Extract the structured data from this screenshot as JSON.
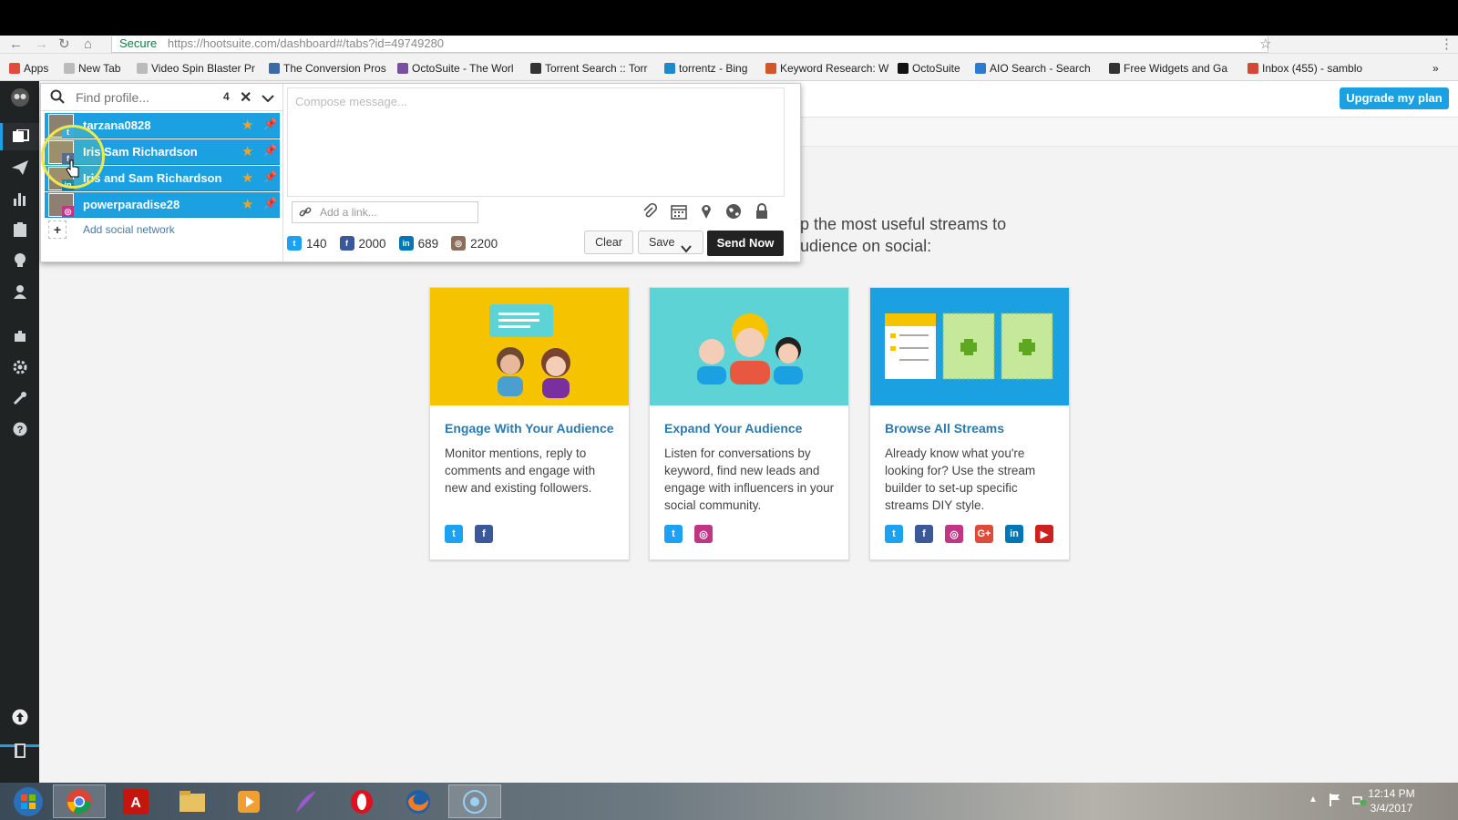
{
  "browser": {
    "secure_label": "Secure",
    "url": "https://hootsuite.com/dashboard#/tabs?id=49749280",
    "bookmarks": [
      {
        "label": "Apps",
        "color": "#e34b3c"
      },
      {
        "label": "New Tab",
        "color": "#bbbbbb"
      },
      {
        "label": "Video Spin Blaster Pr",
        "color": "#bbbbbb"
      },
      {
        "label": "The Conversion Pros",
        "color": "#3b6aa6"
      },
      {
        "label": "OctoSuite - The Worl",
        "color": "#7b4fa0"
      },
      {
        "label": "Torrent Search :: Torr",
        "color": "#333333"
      },
      {
        "label": "torrentz - Bing",
        "color": "#1e88c8"
      },
      {
        "label": "Keyword Research: W",
        "color": "#d3552a"
      },
      {
        "label": "OctoSuite",
        "color": "#111111"
      },
      {
        "label": "AIO Search - Search",
        "color": "#2d7bd1"
      },
      {
        "label": "Free Widgets and Ga",
        "color": "#333333"
      },
      {
        "label": "Inbox (455) - samblo",
        "color": "#d44638"
      }
    ],
    "more": "»"
  },
  "topbar": {
    "upgrade_label": "Upgrade my plan",
    "intro_text": "p the most useful streams to\nudience on social:"
  },
  "composer": {
    "find_placeholder": "Find profile...",
    "selected_count": "4",
    "profiles": [
      {
        "name": "tarzana0828",
        "network": "twitter"
      },
      {
        "name": "Iris Sam Richardson",
        "network": "facebook"
      },
      {
        "name": "Iris and Sam Richardson",
        "network": "linkedin"
      },
      {
        "name": "powerparadise28",
        "network": "instagram"
      }
    ],
    "add_network_label": "Add social network",
    "message_placeholder": "Compose message...",
    "link_placeholder": "Add a link...",
    "counts": [
      {
        "network": "twitter",
        "value": "140",
        "color": "#1da1f2"
      },
      {
        "network": "facebook",
        "value": "2000",
        "color": "#3b5998"
      },
      {
        "network": "linkedin",
        "value": "689",
        "color": "#0077b5"
      },
      {
        "network": "instagram",
        "value": "2200",
        "color": "#8a6d5a"
      }
    ],
    "clear_label": "Clear",
    "save_label": "Save",
    "send_label": "Send Now"
  },
  "cards": [
    {
      "title": "Engage With Your Audience",
      "body": "Monitor mentions, reply to comments and engage with new and existing followers.",
      "bg": "#f6c300",
      "networks": [
        "twitter",
        "facebook"
      ]
    },
    {
      "title": "Expand Your Audience",
      "body": "Listen for conversations by keyword, find new leads and engage with influencers in your social community.",
      "bg": "#5ed3d5",
      "networks": [
        "twitter",
        "instagram"
      ]
    },
    {
      "title": "Browse All Streams",
      "body": "Already know what you're looking for? Use the stream builder to set-up specific streams DIY style.",
      "bg": "#1ba1e2",
      "networks": [
        "twitter",
        "facebook",
        "instagram",
        "google-plus",
        "linkedin",
        "youtube"
      ]
    }
  ],
  "taskbar": {
    "time": "12:14 PM",
    "date": "3/4/2017"
  },
  "colors": {
    "accent": "#1ba1e2",
    "sidebar": "#202324",
    "twitter": "#1da1f2",
    "facebook": "#3b5998",
    "instagram": "#c13584",
    "google-plus": "#dd4b39",
    "linkedin": "#0077b5",
    "youtube": "#cd201f"
  }
}
